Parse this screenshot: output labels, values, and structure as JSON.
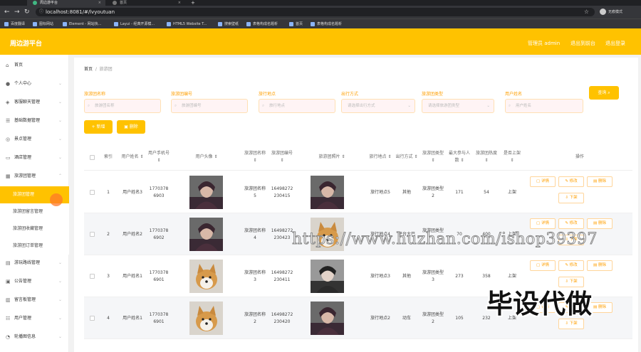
{
  "browser": {
    "tabs": [
      {
        "title": "周边游平台",
        "active": true
      },
      {
        "title": "首页",
        "active": false
      }
    ],
    "url": "localhost:8081/#/lvyoutuan",
    "profile": "无痕模式",
    "bookmarks": [
      "百度翻译",
      "图标网站",
      "Element - 网站快...",
      "Layui - 经典开源模...",
      "HTML5 Website T...",
      "搜索壁纸",
      "表格构成名题析",
      "首页",
      "表格构成名题析"
    ]
  },
  "header": {
    "brand": "周边游平台",
    "links": [
      "管理员 admin",
      "退出到前台",
      "退出登录"
    ]
  },
  "sidebar": {
    "menus": [
      {
        "label": "首页",
        "icon": "home-icon"
      },
      {
        "label": "个人中心",
        "icon": "user-icon"
      },
      {
        "label": "客服聊天管理",
        "icon": "chat-icon"
      },
      {
        "label": "基础数据管理",
        "icon": "list-icon"
      },
      {
        "label": "景点管理",
        "icon": "compass-icon"
      },
      {
        "label": "酒店管理",
        "icon": "hotel-icon"
      },
      {
        "label": "旅游团管理",
        "icon": "grid-icon"
      }
    ],
    "submenus": [
      "旅游团管理",
      "旅游团留言管理",
      "旅游团收藏管理",
      "旅游团订单管理"
    ],
    "menus_after": [
      {
        "label": "游玩路线管理",
        "icon": "route-icon"
      },
      {
        "label": "公告管理",
        "icon": "notice-icon"
      },
      {
        "label": "留言板管理",
        "icon": "board-icon"
      },
      {
        "label": "用户管理",
        "icon": "users-icon"
      },
      {
        "label": "轮播图信息",
        "icon": "image-icon"
      }
    ]
  },
  "breadcrumb": {
    "home": "首页",
    "current": "旅游团"
  },
  "filters": [
    {
      "label": "旅游团名称",
      "placeholder": "旅游团名称",
      "type": "input"
    },
    {
      "label": "旅游团编号",
      "placeholder": "旅游团编号",
      "type": "input"
    },
    {
      "label": "旅行地点",
      "placeholder": "旅行地点",
      "type": "input"
    },
    {
      "label": "出行方式",
      "placeholder": "请选择出行方式",
      "type": "select"
    },
    {
      "label": "旅游团类型",
      "placeholder": "请选择旅游团类型",
      "type": "select"
    },
    {
      "label": "用户姓名",
      "placeholder": "用户姓名",
      "type": "input"
    }
  ],
  "buttons": {
    "search": "查询",
    "add": "新增",
    "delete": "删除"
  },
  "table": {
    "columns": [
      "",
      "索引",
      "用户姓名 ⇕",
      "用户手机号 ⇕",
      "用户头像 ⇕",
      "旅游团名称 ⇕",
      "旅游团编号 ⇕",
      "旅游团照片 ⇕",
      "旅行地点 ⇕",
      "出行方式 ⇕",
      "旅游团类型 ⇕",
      "最大参与人数 ⇕",
      "旅游团热度 ⇕",
      "是否上架 ⇕",
      "操作"
    ],
    "actions": [
      "详情",
      "修改",
      "删除",
      "下架"
    ],
    "rows": [
      {
        "index": "1",
        "name": "用户姓名3",
        "phone": "17703786903",
        "tour": "旅游团名称5",
        "code": "16498272230415",
        "place": "旅行地点5",
        "mode": "其他",
        "type": "旅游团类型2",
        "max": "171",
        "heat": "54",
        "status": "上架",
        "avatar": "man",
        "photo": "man"
      },
      {
        "index": "2",
        "name": "用户姓名2",
        "phone": "17703786902",
        "tour": "旅游团名称4",
        "code": "16498272230423",
        "place": "旅行地点4",
        "mode": "平台大巴",
        "type": "旅游团类型2",
        "max": "70",
        "heat": "400",
        "status": "上架",
        "avatar": "man",
        "photo": "dog"
      },
      {
        "index": "3",
        "name": "用户姓名1",
        "phone": "17703786901",
        "tour": "旅游团名称3",
        "code": "16498272230411",
        "place": "旅行地点3",
        "mode": "其他",
        "type": "旅游团类型3",
        "max": "273",
        "heat": "358",
        "status": "上架",
        "avatar": "dog",
        "photo": "man2"
      },
      {
        "index": "4",
        "name": "用户姓名1",
        "phone": "17703786901",
        "tour": "旅游团名称2",
        "code": "16498272230420",
        "place": "旅行地点2",
        "mode": "动车",
        "type": "旅游团类型2",
        "max": "105",
        "heat": "232",
        "status": "上架",
        "avatar": "dog",
        "photo": "man"
      }
    ]
  },
  "watermark": "https://www.huzhan.com/ishop39397",
  "overlay_text": "毕设代做",
  "colors": {
    "accent": "#ffc200",
    "label": "#ff9f00"
  }
}
